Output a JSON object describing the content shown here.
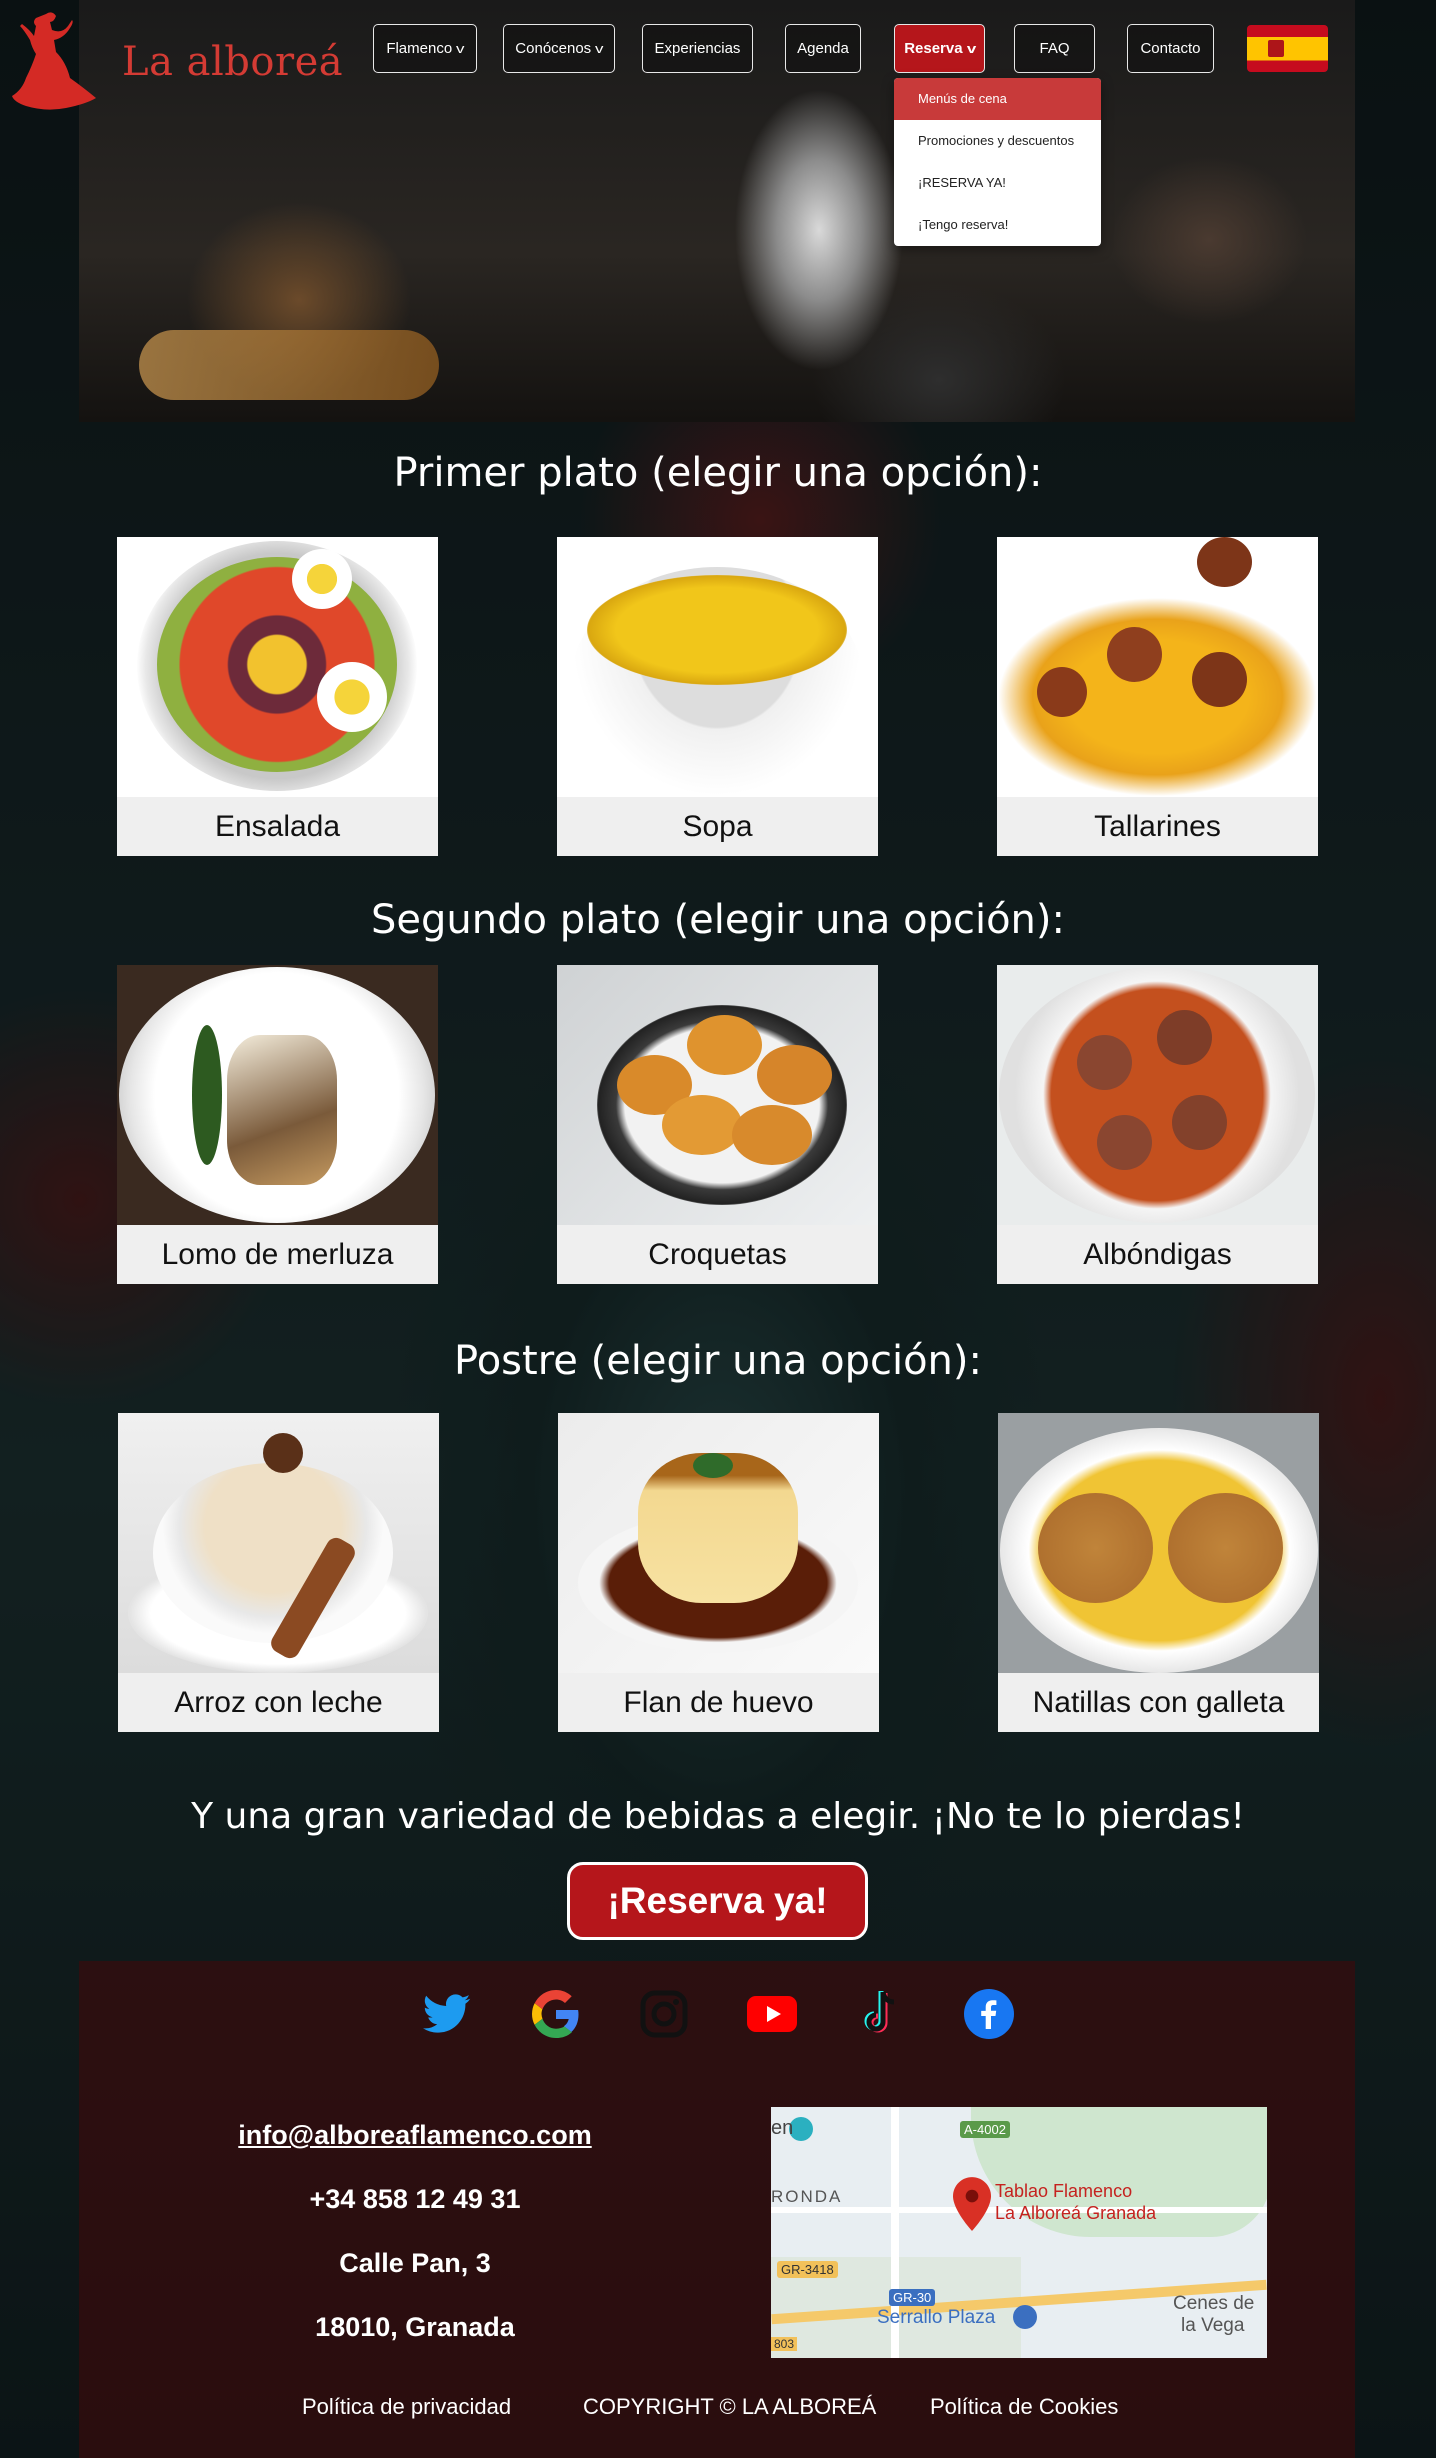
{
  "header": {
    "logo_text": "La alboreá",
    "nav": [
      {
        "label": "Flamenco",
        "dropdown": true
      },
      {
        "label": "Conócenos",
        "dropdown": true
      },
      {
        "label": "Experiencias",
        "dropdown": false
      },
      {
        "label": "Agenda",
        "dropdown": false
      },
      {
        "label": "Reserva",
        "dropdown": true,
        "active": true
      },
      {
        "label": "FAQ",
        "dropdown": false
      },
      {
        "label": "Contacto",
        "dropdown": false
      }
    ],
    "language_flag": "spain-flag-icon",
    "reserva_menu": [
      "Menús de cena",
      "Promociones y descuentos",
      "¡RESERVA YA!",
      "¡Tengo reserva!"
    ]
  },
  "menu": {
    "first_course": {
      "title": "Primer plato (elegir una opción):",
      "items": [
        "Ensalada",
        "Sopa",
        "Tallarines"
      ]
    },
    "second_course": {
      "title": "Segundo plato (elegir una opción):",
      "items": [
        "Lomo de merluza",
        "Croquetas",
        "Albóndigas"
      ]
    },
    "dessert": {
      "title": "Postre (elegir una opción):",
      "items": [
        "Arroz con leche",
        "Flan de huevo",
        "Natillas con galleta"
      ]
    }
  },
  "cta": {
    "text": "Y una gran variedad de bebidas a elegir. ¡No te lo pierdas!",
    "button": "¡Reserva ya!"
  },
  "footer": {
    "social_icons": [
      "twitter-icon",
      "google-icon",
      "instagram-icon",
      "youtube-icon",
      "tiktok-icon",
      "facebook-icon"
    ],
    "email": "info@alboreaflamenco.com",
    "phone": "+34 858 12 49 31",
    "street": "Calle Pan, 3",
    "city": "18010, Granada",
    "map": {
      "place_label_1": "Tablao Flamenco",
      "place_label_2": "La Alboreá Granada",
      "road_a": "A-4002",
      "road_b": "GR-3418",
      "road_c": "GR-30",
      "area_1": "RONDA",
      "area_2": "Serrallo Plaza",
      "area_3": "Cenes de",
      "area_4": "la Vega",
      "edge_1": "en",
      "edge_2": "803"
    },
    "privacy": "Política de privacidad",
    "copyright": "COPYRIGHT © LA ALBOREÁ",
    "cookies": "Política de Cookies"
  },
  "colors": {
    "accent": "#b5161b",
    "logo": "#d43b34"
  }
}
